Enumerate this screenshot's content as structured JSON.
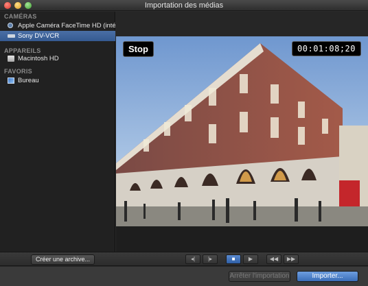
{
  "window": {
    "title": "Importation des médias"
  },
  "sidebar": {
    "sections": [
      {
        "heading": "CAMÉRAS",
        "items": [
          {
            "label": "Apple Caméra FaceTime HD (intégrée)",
            "icon": "camera-icon",
            "selected": false
          },
          {
            "label": "Sony DV-VCR",
            "icon": "vcr-icon",
            "selected": true
          }
        ]
      },
      {
        "heading": "APPAREILS",
        "items": [
          {
            "label": "Macintosh HD",
            "icon": "hard-drive-icon",
            "selected": false
          }
        ]
      },
      {
        "heading": "FAVORIS",
        "items": [
          {
            "label": "Bureau",
            "icon": "desktop-folder-icon",
            "selected": false
          }
        ]
      }
    ]
  },
  "viewer": {
    "status_label": "Stop",
    "timecode": "00:01:08;20"
  },
  "controls": {
    "archive_label": "Créer une archive...",
    "transport": [
      {
        "icon": "previous-frame-icon",
        "glyph": "◂|"
      },
      {
        "icon": "next-frame-icon",
        "glyph": "|▸"
      },
      {
        "icon": "stop-icon",
        "glyph": "■"
      },
      {
        "icon": "play-icon",
        "glyph": "▶"
      },
      {
        "icon": "rewind-icon",
        "glyph": "◀◀"
      },
      {
        "icon": "fast-forward-icon",
        "glyph": "▶▶"
      }
    ]
  },
  "footer": {
    "stop_import_label": "Arrêter l'importation",
    "import_label": "Importer..."
  },
  "colors": {
    "accent": "#3a6db8",
    "selection": "#4a6fa5"
  }
}
